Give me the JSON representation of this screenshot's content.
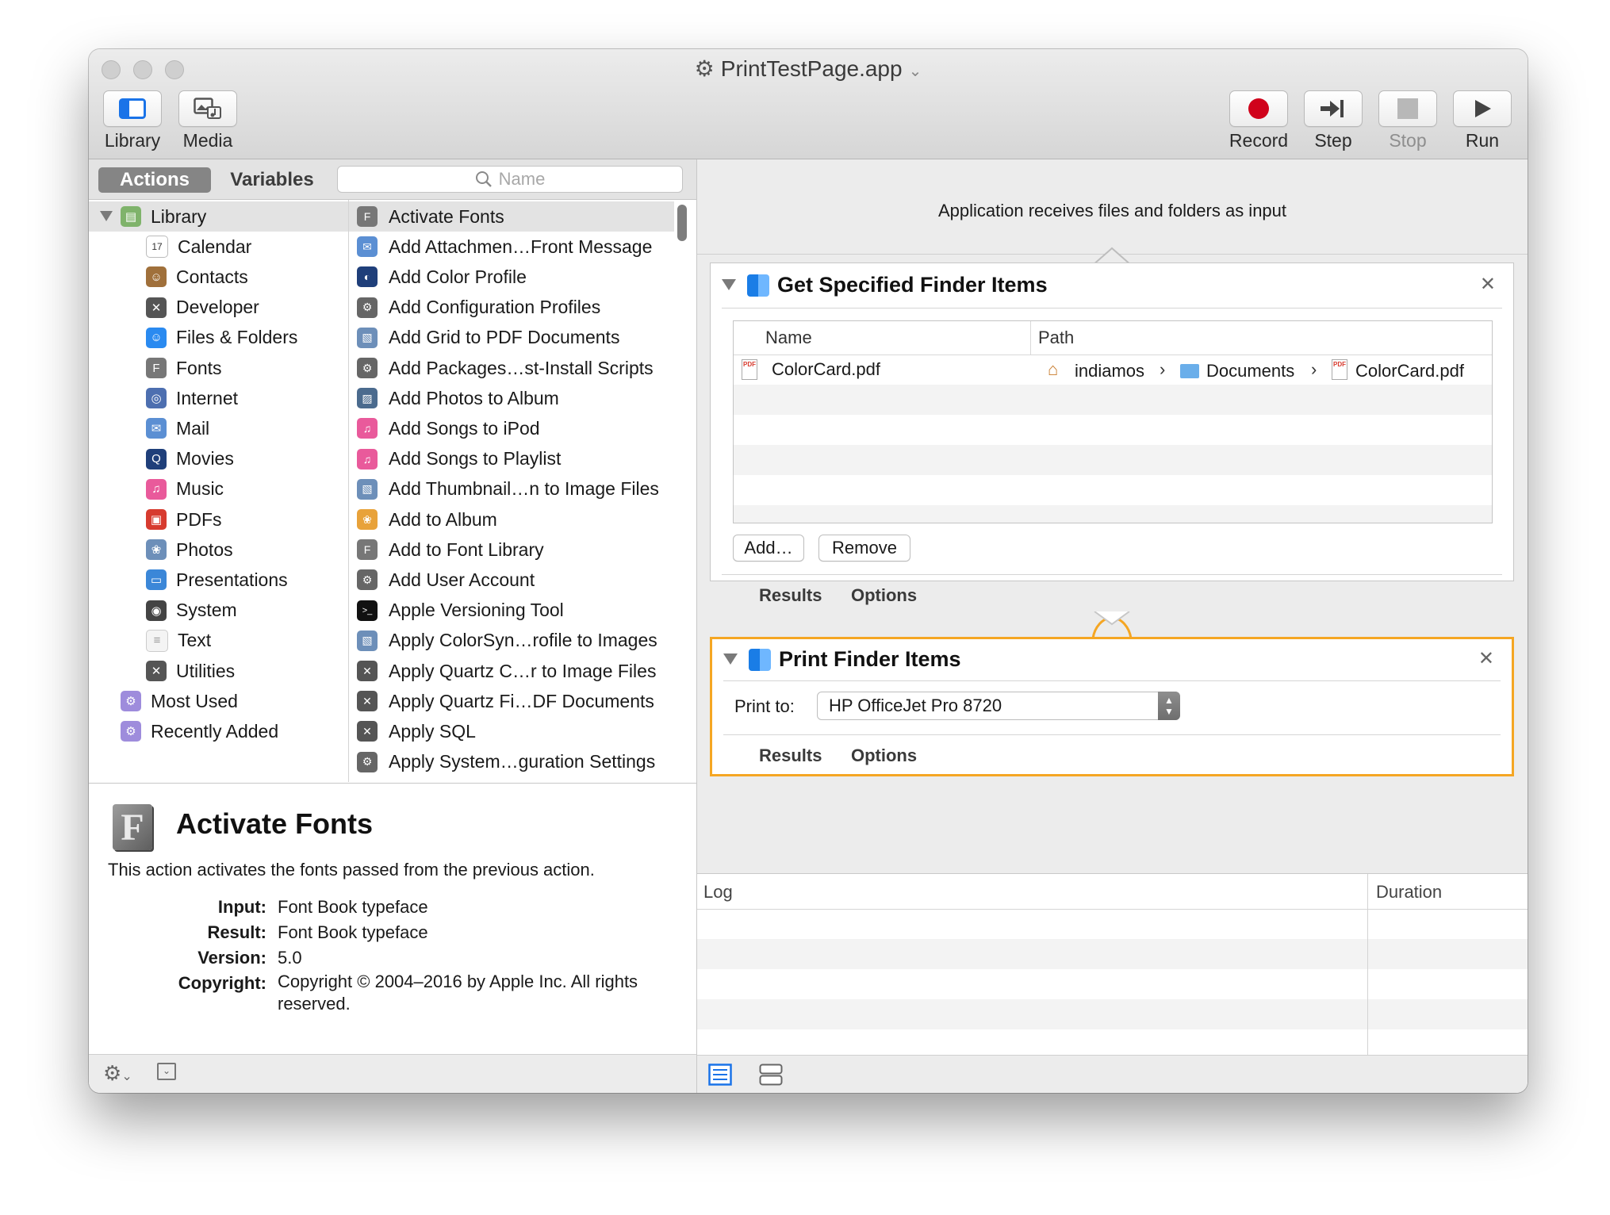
{
  "window": {
    "title": "PrintTestPage.app"
  },
  "toolbar": {
    "library": "Library",
    "media": "Media",
    "record": "Record",
    "step": "Step",
    "stop": "Stop",
    "run": "Run"
  },
  "library_tabs": {
    "actions": "Actions",
    "variables": "Variables"
  },
  "search": {
    "placeholder": "Name"
  },
  "categories": [
    {
      "label": "Library",
      "icon": "library-icon",
      "color": "#7fb36b"
    },
    {
      "label": "Calendar",
      "icon": "calendar-icon",
      "color": "#e2463b"
    },
    {
      "label": "Contacts",
      "icon": "contacts-icon",
      "color": "#a0703b"
    },
    {
      "label": "Developer",
      "icon": "tools-icon",
      "color": "#555555"
    },
    {
      "label": "Files & Folders",
      "icon": "finder-icon",
      "color": "#2a8af0"
    },
    {
      "label": "Fonts",
      "icon": "font-icon",
      "color": "#777777"
    },
    {
      "label": "Internet",
      "icon": "globe-icon",
      "color": "#4d6fb0"
    },
    {
      "label": "Mail",
      "icon": "mail-icon",
      "color": "#5b8fd3"
    },
    {
      "label": "Movies",
      "icon": "quicktime-icon",
      "color": "#1f3f7a"
    },
    {
      "label": "Music",
      "icon": "music-icon",
      "color": "#e95a9b"
    },
    {
      "label": "PDFs",
      "icon": "pdf-icon",
      "color": "#d73b2f"
    },
    {
      "label": "Photos",
      "icon": "photos-icon",
      "color": "#6d8fb9"
    },
    {
      "label": "Presentations",
      "icon": "presentation-icon",
      "color": "#3b87d8"
    },
    {
      "label": "System",
      "icon": "system-icon",
      "color": "#444444"
    },
    {
      "label": "Text",
      "icon": "text-icon",
      "color": "#bdbdbd"
    },
    {
      "label": "Utilities",
      "icon": "tools-icon",
      "color": "#555555"
    },
    {
      "label": "Most Used",
      "icon": "smart-folder-icon",
      "color": "#9e8cdc"
    },
    {
      "label": "Recently Added",
      "icon": "smart-folder-icon",
      "color": "#9e8cdc"
    }
  ],
  "actions": [
    {
      "label": "Activate Fonts",
      "icon": "font-icon",
      "color": "#777777"
    },
    {
      "label": "Add Attachmen…Front Message",
      "icon": "mail-icon",
      "color": "#5b8fd3"
    },
    {
      "label": "Add Color Profile",
      "icon": "colorsync-icon",
      "color": "#1f3f7a"
    },
    {
      "label": "Add Configuration Profiles",
      "icon": "automator-icon",
      "color": "#666666"
    },
    {
      "label": "Add Grid to PDF Documents",
      "icon": "preview-icon",
      "color": "#6d8fb9"
    },
    {
      "label": "Add Packages…st-Install Scripts",
      "icon": "automator-icon",
      "color": "#666666"
    },
    {
      "label": "Add Photos to Album",
      "icon": "iphoto-icon",
      "color": "#4b6b8e"
    },
    {
      "label": "Add Songs to iPod",
      "icon": "music-icon",
      "color": "#e95a9b"
    },
    {
      "label": "Add Songs to Playlist",
      "icon": "music-icon",
      "color": "#e95a9b"
    },
    {
      "label": "Add Thumbnail…n to Image Files",
      "icon": "preview-icon",
      "color": "#6d8fb9"
    },
    {
      "label": "Add to Album",
      "icon": "photos-icon",
      "color": "#e8a23a"
    },
    {
      "label": "Add to Font Library",
      "icon": "font-icon",
      "color": "#777777"
    },
    {
      "label": "Add User Account",
      "icon": "automator-icon",
      "color": "#666666"
    },
    {
      "label": "Apple Versioning Tool",
      "icon": "terminal-icon",
      "color": "#111111"
    },
    {
      "label": "Apply ColorSyn…rofile to Images",
      "icon": "preview-icon",
      "color": "#6d8fb9"
    },
    {
      "label": "Apply Quartz C…r to Image Files",
      "icon": "tools-icon",
      "color": "#555555"
    },
    {
      "label": "Apply Quartz Fi…DF Documents",
      "icon": "tools-icon",
      "color": "#555555"
    },
    {
      "label": "Apply SQL",
      "icon": "tools-icon",
      "color": "#555555"
    },
    {
      "label": "Apply System…guration Settings",
      "icon": "automator-icon",
      "color": "#666666"
    }
  ],
  "description": {
    "title": "Activate Fonts",
    "text": "This action activates the fonts passed from the previous action.",
    "input_label": "Input:",
    "input": "Font Book typeface",
    "result_label": "Result:",
    "result": "Font Book typeface",
    "version_label": "Version:",
    "version": "5.0",
    "copyright_label": "Copyright:",
    "copyright": "Copyright © 2004–2016 by Apple Inc. All rights reserved."
  },
  "workflow": {
    "input_text": "Application receives files and folders as input",
    "get_items": {
      "title": "Get Specified Finder Items",
      "col_name": "Name",
      "col_path": "Path",
      "row_name": "ColorCard.pdf",
      "path_home": "indiamos",
      "path_folder": "Documents",
      "path_file": "ColorCard.pdf",
      "add": "Add…",
      "remove": "Remove",
      "results": "Results",
      "options": "Options"
    },
    "print_items": {
      "title": "Print Finder Items",
      "print_to_label": "Print to:",
      "printer": "HP OfficeJet Pro 8720",
      "results": "Results",
      "options": "Options"
    }
  },
  "log": {
    "col_log": "Log",
    "col_duration": "Duration"
  },
  "colors": {
    "highlight": "#f5a623",
    "record": "#d0021b"
  }
}
